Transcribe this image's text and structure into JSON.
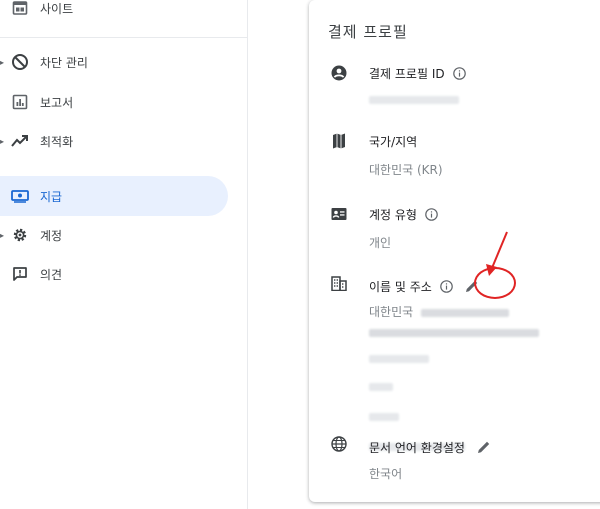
{
  "sidebar": {
    "items": [
      {
        "label": "사이트",
        "icon": "site-icon"
      },
      {
        "label": "차단 관리",
        "icon": "block-icon"
      },
      {
        "label": "보고서",
        "icon": "report-icon"
      },
      {
        "label": "최적화",
        "icon": "trending-up-icon"
      },
      {
        "label": "지급",
        "icon": "payments-icon"
      },
      {
        "label": "계정",
        "icon": "gear-icon"
      },
      {
        "label": "의견",
        "icon": "feedback-icon"
      }
    ],
    "active_item": "지급"
  },
  "card": {
    "title": "결제 프로필",
    "profile_id": {
      "label": "결제 프로필 ID"
    },
    "country": {
      "label": "국가/지역",
      "value": "대한민국 (KR)"
    },
    "account_type": {
      "label": "계정 유형",
      "value": "개인"
    },
    "name_address": {
      "label": "이름 및 주소",
      "value_prefix": "대한민국"
    },
    "doc_language": {
      "label": "문서 언어 환경설정",
      "value": "한국어"
    }
  },
  "colors": {
    "active_bg": "#e8f0fe",
    "active_text": "#1967d2",
    "annotation": "#e02424",
    "icon": "#5f6368"
  }
}
